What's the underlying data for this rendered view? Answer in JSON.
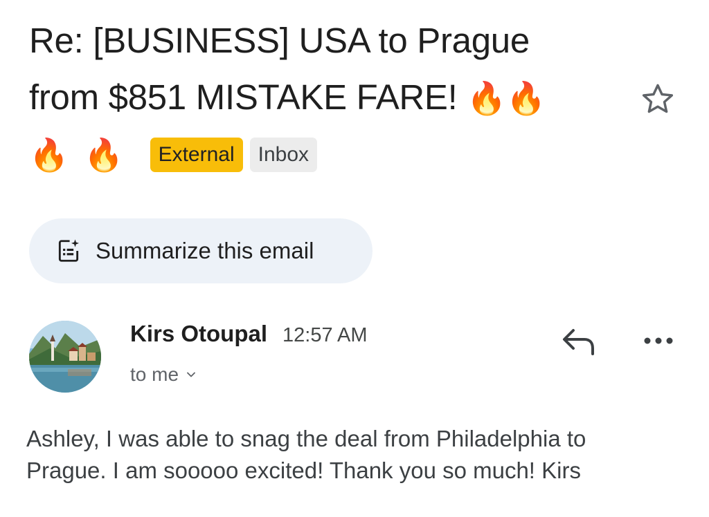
{
  "email": {
    "subject_line1": "Re: [BUSINESS] USA to Prague",
    "subject_line2": "from $851 MISTAKE FARE!",
    "fire_emoji": "🔥",
    "labels": [
      "External",
      "Inbox"
    ],
    "starred": false,
    "summarize_label": "Summarize this email",
    "sender_name": "Kirs Otoupal",
    "time": "12:57 AM",
    "recipient": "to me",
    "body_line1": "Ashley, I was able to snag the deal from Philadelphia to",
    "body_line2": "Prague. I am sooooo excited! Thank you so much! Kirs"
  },
  "icons": {
    "star": "star-outline-icon",
    "summarize": "summarize-sparkle-icon",
    "reply": "reply-icon",
    "more": "more-horizontal-icon",
    "expand": "chevron-down-icon"
  },
  "colors": {
    "external_label": "#f8bd09",
    "inbox_label": "#ececec",
    "summarize_bg": "#edf2f8",
    "fire": "#f05a1a"
  }
}
